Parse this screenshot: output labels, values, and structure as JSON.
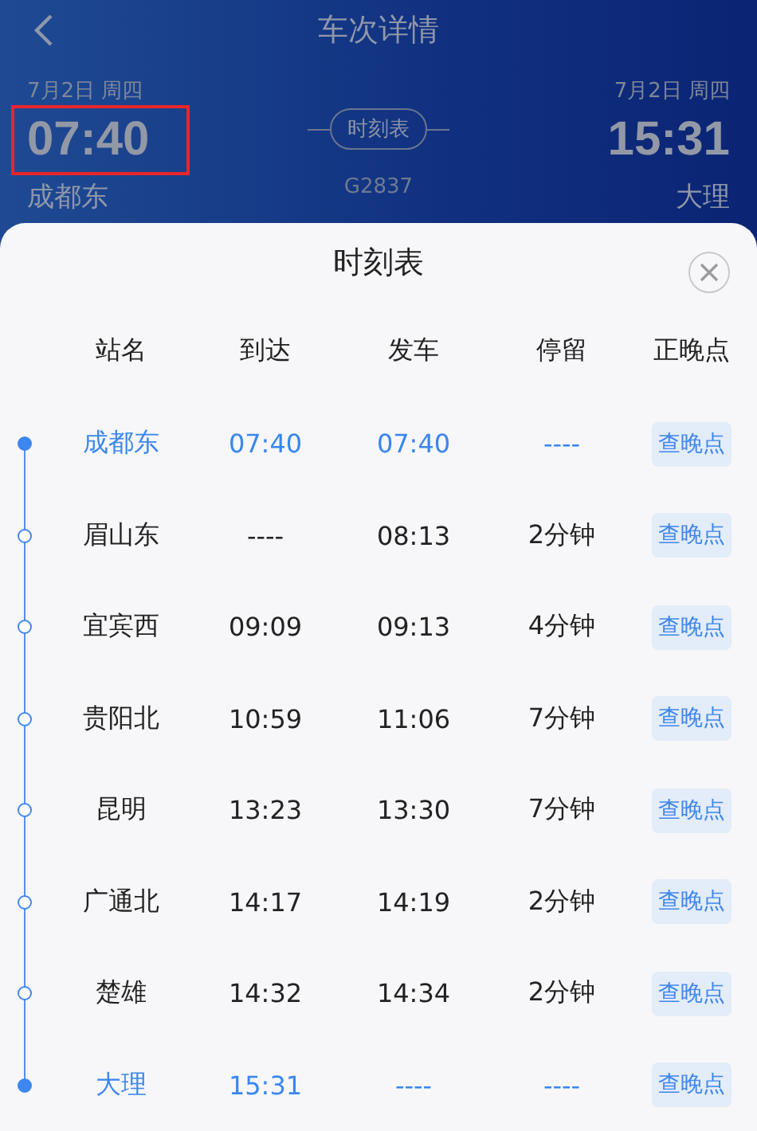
{
  "header": {
    "title": "车次详情",
    "departure": {
      "date": "7月2日 周四",
      "time": "07:40",
      "station": "成都东",
      "highlighted": true
    },
    "arrival": {
      "date": "7月2日 周四",
      "time": "15:31",
      "station": "大理",
      "highlighted": false
    },
    "schedule_button": "时刻表",
    "train_number": "G2837"
  },
  "sheet": {
    "title": "时刻表",
    "columns": [
      "站名",
      "到达",
      "发车",
      "停留",
      "正晚点"
    ],
    "rows": [
      {
        "station": "成都东",
        "arrive": "07:40",
        "depart": "07:40",
        "stop": "----",
        "action": "查晚点",
        "highlighted": true
      },
      {
        "station": "眉山东",
        "arrive": "----",
        "depart": "08:13",
        "stop": "2分钟",
        "action": "查晚点",
        "highlighted": false
      },
      {
        "station": "宜宾西",
        "arrive": "09:09",
        "depart": "09:13",
        "stop": "4分钟",
        "action": "查晚点",
        "highlighted": false
      },
      {
        "station": "贵阳北",
        "arrive": "10:59",
        "depart": "11:06",
        "stop": "7分钟",
        "action": "查晚点",
        "highlighted": false
      },
      {
        "station": "昆明",
        "arrive": "13:23",
        "depart": "13:30",
        "stop": "7分钟",
        "action": "查晚点",
        "highlighted": false
      },
      {
        "station": "广通北",
        "arrive": "14:17",
        "depart": "14:19",
        "stop": "2分钟",
        "action": "查晚点",
        "highlighted": false
      },
      {
        "station": "楚雄",
        "arrive": "14:32",
        "depart": "14:34",
        "stop": "2分钟",
        "action": "查晚点",
        "highlighted": false
      },
      {
        "station": "大理",
        "arrive": "15:31",
        "depart": "----",
        "stop": "----",
        "action": "查晚点",
        "highlighted": true
      }
    ]
  }
}
